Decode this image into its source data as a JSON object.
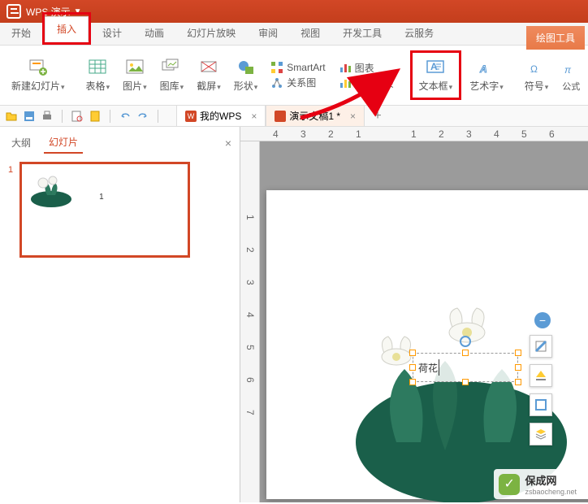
{
  "titlebar": {
    "app": "WPS 演示"
  },
  "tabs": {
    "start": "开始",
    "insert": "插入",
    "design": "设计",
    "animation": "动画",
    "slideshow": "幻灯片放映",
    "review": "审阅",
    "view": "视图",
    "devtools": "开发工具",
    "cloud": "云服务",
    "draw": "绘图工具"
  },
  "ribbon": {
    "new_slide": "新建幻灯片",
    "table": "表格",
    "picture": "图片",
    "gallery": "图库",
    "screenshot": "截屏",
    "shapes": "形状",
    "smartart": "SmartArt",
    "chart": "图表",
    "relation": "关系图",
    "online_chart": "在线图表",
    "textbox": "文本框",
    "wordart": "艺术字",
    "symbol": "符号",
    "formula": "公式"
  },
  "doc_tabs": {
    "wps": "我的WPS",
    "presentation": "演示文稿1 *"
  },
  "pane": {
    "outline": "大纲",
    "slides": "幻灯片"
  },
  "thumb": {
    "num": "1",
    "inner": "1"
  },
  "textbox_content": "荷花",
  "ruler_h": [
    "4",
    "3",
    "2",
    "1",
    "1",
    "2",
    "3",
    "4",
    "5",
    "6"
  ],
  "ruler_v": [
    "1",
    "2",
    "3",
    "4",
    "5",
    "6",
    "7"
  ],
  "watermark": {
    "title": "保成网",
    "sub": "zsbaocheng.net"
  }
}
